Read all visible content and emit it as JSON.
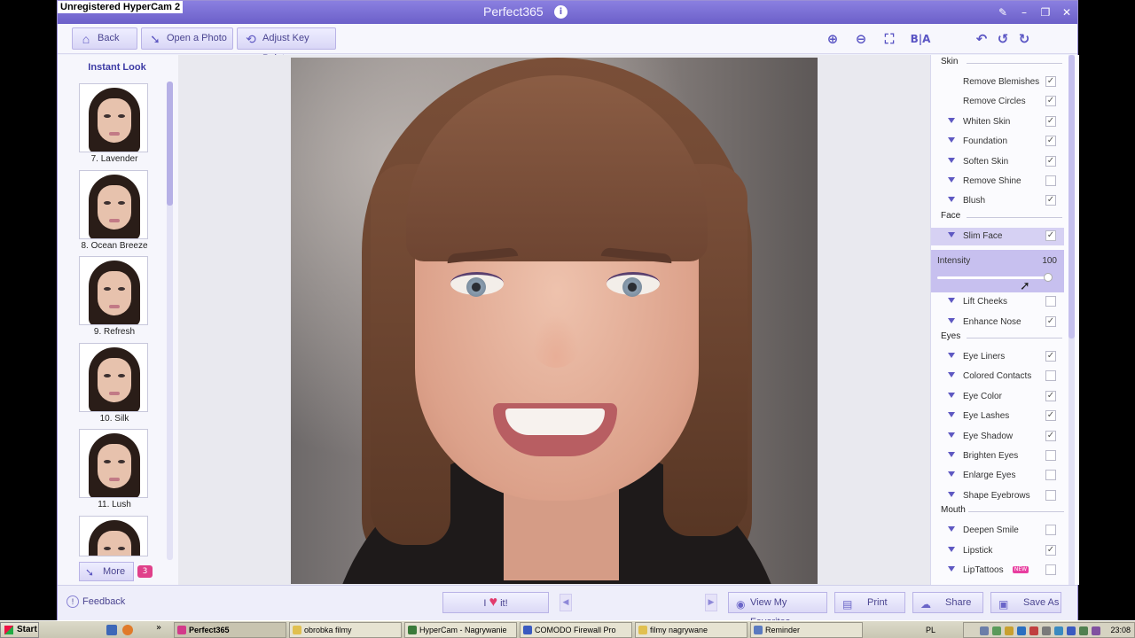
{
  "window": {
    "watermark": "Unregistered HyperCam 2",
    "title": "Perfect365",
    "info_glyph": "i",
    "buttons": {
      "help": "✎",
      "minimize": "–",
      "restore": "❐",
      "close": "✕"
    }
  },
  "toolbar": {
    "back": "Back",
    "open_photo": "Open a Photo",
    "adjust_key_points": "Adjust Key Points",
    "before_after": "B|A"
  },
  "left_panel": {
    "header": "Instant Look",
    "looks": [
      {
        "label": "7. Lavender"
      },
      {
        "label": "8. Ocean Breeze"
      },
      {
        "label": "9. Refresh"
      },
      {
        "label": "10. Silk"
      },
      {
        "label": "11. Lush"
      },
      {
        "label": ""
      }
    ],
    "more_label": "More",
    "more_count": "3"
  },
  "right_panel": {
    "sections": {
      "skin": "Skin",
      "face": "Face",
      "eyes": "Eyes",
      "mouth": "Mouth"
    },
    "skin": [
      {
        "label": "Remove Blemishes",
        "expandable": false,
        "checked": true
      },
      {
        "label": "Remove Circles",
        "expandable": false,
        "checked": true
      },
      {
        "label": "Whiten Skin",
        "expandable": true,
        "checked": true
      },
      {
        "label": "Foundation",
        "expandable": true,
        "checked": true
      },
      {
        "label": "Soften Skin",
        "expandable": true,
        "checked": true
      },
      {
        "label": "Remove Shine",
        "expandable": true,
        "checked": false
      },
      {
        "label": "Blush",
        "expandable": true,
        "checked": true
      }
    ],
    "face": [
      {
        "label": "Slim Face",
        "expandable": true,
        "checked": true,
        "selected": true
      },
      {
        "label": "Lift Cheeks",
        "expandable": true,
        "checked": false
      },
      {
        "label": "Enhance Nose",
        "expandable": true,
        "checked": true
      }
    ],
    "intensity": {
      "label": "Intensity",
      "value": "100",
      "fraction": 1.0
    },
    "eyes": [
      {
        "label": "Eye Liners",
        "expandable": true,
        "checked": true
      },
      {
        "label": "Colored Contacts",
        "expandable": true,
        "checked": false
      },
      {
        "label": "Eye Color",
        "expandable": true,
        "checked": true
      },
      {
        "label": "Eye Lashes",
        "expandable": true,
        "checked": true
      },
      {
        "label": "Eye Shadow",
        "expandable": true,
        "checked": true
      },
      {
        "label": "Brighten Eyes",
        "expandable": true,
        "checked": false
      },
      {
        "label": "Enlarge Eyes",
        "expandable": true,
        "checked": false
      },
      {
        "label": "Shape Eyebrows",
        "expandable": true,
        "checked": false
      }
    ],
    "mouth": [
      {
        "label": "Deepen Smile",
        "expandable": true,
        "checked": false
      },
      {
        "label": "Lipstick",
        "expandable": true,
        "checked": true
      },
      {
        "label": "LipTattoos",
        "expandable": true,
        "checked": false,
        "badge": "NEW"
      }
    ]
  },
  "bottom_bar": {
    "feedback": "Feedback",
    "love_prefix": "I",
    "love_suffix": "it!",
    "view_favorites": "View My Favorites",
    "print": "Print",
    "share": "Share",
    "save_as": "Save As"
  },
  "taskbar": {
    "start": "Start",
    "tasks": [
      {
        "label": "Perfect365",
        "active": true
      },
      {
        "label": "obrobka filmy",
        "active": false
      },
      {
        "label": "HyperCam - Nagrywanie",
        "active": false
      },
      {
        "label": "COMODO Firewall Pro",
        "active": false
      },
      {
        "label": "filmy nagrywane",
        "active": false
      },
      {
        "label": "Reminder",
        "active": false
      }
    ],
    "language": "PL",
    "clock": "23:08"
  },
  "colors": {
    "accent": "#6c60c9",
    "selected_row": "#d6d1f3",
    "intensity_bg": "#c7c0ef",
    "heart": "#e23b6d",
    "badge": "#e0408a"
  }
}
